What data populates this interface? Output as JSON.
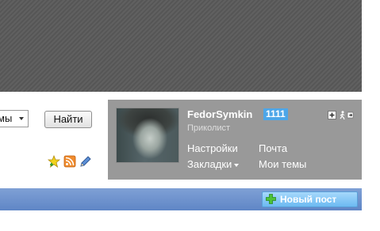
{
  "search": {
    "select_value": "мы",
    "button_label": "Найти"
  },
  "toolbar_icons": [
    "star-add-icon",
    "rss-icon",
    "pencil-icon"
  ],
  "user_panel": {
    "username": "FedorSymkin",
    "score": "1111",
    "rank": "Приколист",
    "links": {
      "settings": "Настройки",
      "mail": "Почта",
      "bookmarks": "Закладки",
      "my_topics": "Мои темы"
    },
    "icons": [
      "plus-icon",
      "logout-icon"
    ]
  },
  "nav": {
    "new_post_label": "Новый пост"
  },
  "colors": {
    "banner": "#5a5a5a",
    "panel": "#999999",
    "score_badge": "#4da6e8",
    "nav_bar": "#6b8fcb",
    "new_post_button": "#7cc2f4"
  }
}
